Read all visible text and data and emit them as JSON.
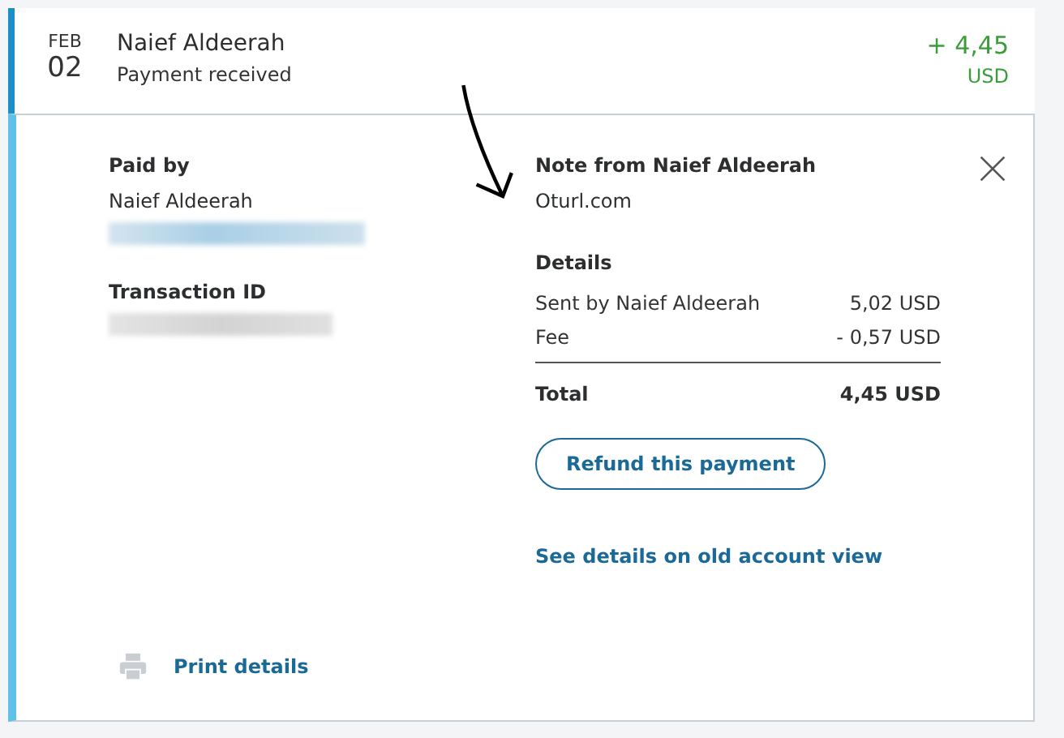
{
  "transaction": {
    "month": "FEB",
    "day": "02",
    "name": "Naief Aldeerah",
    "status": "Payment received",
    "amount": "+ 4,45",
    "currency": "USD",
    "expanded": true
  },
  "paid_by": {
    "heading": "Paid by",
    "name": "Naief Aldeerah"
  },
  "transaction_id": {
    "heading": "Transaction ID"
  },
  "note": {
    "heading": "Note from Naief Aldeerah",
    "text": "Oturl.com"
  },
  "details": {
    "heading": "Details",
    "rows": [
      {
        "label": "Sent by Naief Aldeerah",
        "value": "5,02 USD"
      },
      {
        "label": "Fee",
        "value": "- 0,57 USD"
      }
    ],
    "total": {
      "label": "Total",
      "value": "4,45 USD"
    }
  },
  "refund_button": "Refund this payment",
  "old_view_link": "See details on old account view",
  "print_link": "Print details"
}
